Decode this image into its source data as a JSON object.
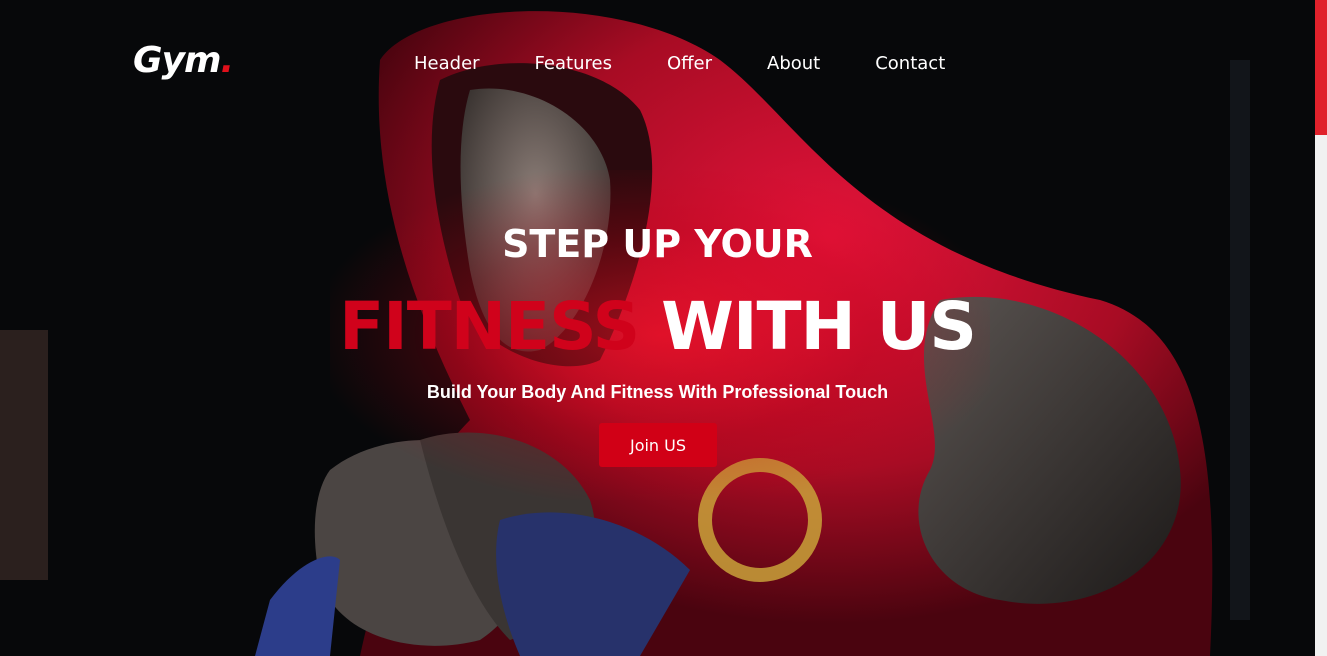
{
  "logo": {
    "text": "Gym",
    "dot": "."
  },
  "nav": {
    "items": [
      {
        "label": "Header"
      },
      {
        "label": "Features"
      },
      {
        "label": "Offer"
      },
      {
        "label": "About"
      },
      {
        "label": "Contact"
      }
    ]
  },
  "hero": {
    "line1": "STEP UP YOUR",
    "line2_red": "FITNESS",
    "line2_white": "WITH US",
    "subtitle": "Build Your Body And Fitness With Professional Touch",
    "cta_label": "Join US"
  },
  "colors": {
    "accent": "#d0021b",
    "button": "#d10016",
    "scroll_thumb": "#e0212b"
  },
  "background_image": "boxer-in-red-hoodie"
}
